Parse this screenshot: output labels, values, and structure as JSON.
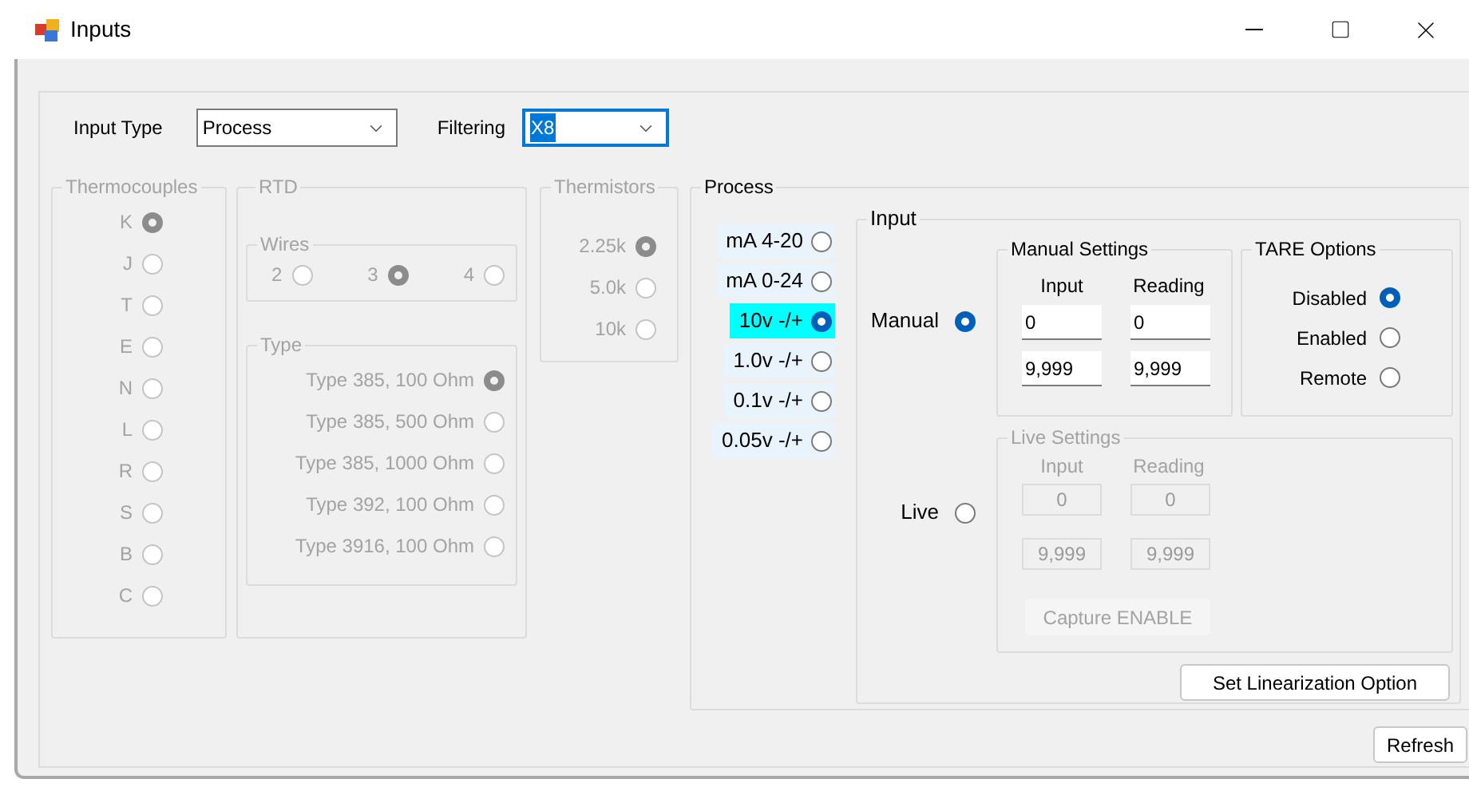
{
  "window": {
    "title": "Inputs"
  },
  "input_type": {
    "label": "Input Type",
    "value": "Process"
  },
  "filtering": {
    "label": "Filtering",
    "value": "X8",
    "focused": true
  },
  "thermocouples": {
    "title": "Thermocouples",
    "disabled": true,
    "options": [
      {
        "label": "K",
        "selected": true
      },
      {
        "label": "J",
        "selected": false
      },
      {
        "label": "T",
        "selected": false
      },
      {
        "label": "E",
        "selected": false
      },
      {
        "label": "N",
        "selected": false
      },
      {
        "label": "L",
        "selected": false
      },
      {
        "label": "R",
        "selected": false
      },
      {
        "label": "S",
        "selected": false
      },
      {
        "label": "B",
        "selected": false
      },
      {
        "label": "C",
        "selected": false
      }
    ]
  },
  "rtd": {
    "title": "RTD",
    "disabled": true,
    "wires": {
      "title": "Wires",
      "options": [
        {
          "label": "2",
          "selected": false
        },
        {
          "label": "3",
          "selected": true
        },
        {
          "label": "4",
          "selected": false
        }
      ]
    },
    "type": {
      "title": "Type",
      "options": [
        {
          "label": "Type 385, 100 Ohm",
          "selected": true
        },
        {
          "label": "Type 385, 500 Ohm",
          "selected": false
        },
        {
          "label": "Type 385, 1000 Ohm",
          "selected": false
        },
        {
          "label": "Type 392, 100 Ohm",
          "selected": false
        },
        {
          "label": "Type 3916, 100 Ohm",
          "selected": false
        }
      ]
    }
  },
  "thermistors": {
    "title": "Thermistors",
    "disabled": true,
    "options": [
      {
        "label": "2.25k",
        "selected": true
      },
      {
        "label": "5.0k",
        "selected": false
      },
      {
        "label": "10k",
        "selected": false
      }
    ]
  },
  "process": {
    "title": "Process",
    "disabled": false,
    "options": [
      {
        "label": "mA 4-20",
        "selected": false
      },
      {
        "label": "mA 0-24",
        "selected": false
      },
      {
        "label": "10v -/+",
        "selected": true
      },
      {
        "label": "1.0v -/+",
        "selected": false
      },
      {
        "label": "0.1v -/+",
        "selected": false
      },
      {
        "label": "0.05v -/+",
        "selected": false
      }
    ],
    "input": {
      "title": "Input",
      "modes": [
        {
          "label": "Manual",
          "selected": true
        },
        {
          "label": "Live",
          "selected": false
        }
      ],
      "manual_settings": {
        "title": "Manual Settings",
        "disabled": false,
        "columns": [
          "Input",
          "Reading"
        ],
        "rows": [
          [
            "0",
            "0"
          ],
          [
            "9,999",
            "9,999"
          ]
        ]
      },
      "tare_options": {
        "title": "TARE Options",
        "options": [
          {
            "label": "Disabled",
            "selected": true
          },
          {
            "label": "Enabled",
            "selected": false
          },
          {
            "label": "Remote",
            "selected": false
          }
        ]
      },
      "live_settings": {
        "title": "Live Settings",
        "disabled": true,
        "columns": [
          "Input",
          "Reading"
        ],
        "rows": [
          [
            "0",
            "0"
          ],
          [
            "9,999",
            "9,999"
          ]
        ],
        "button": "Capture ENABLE"
      },
      "button": "Set Linearization Option"
    }
  },
  "buttons": [
    "Refresh"
  ]
}
